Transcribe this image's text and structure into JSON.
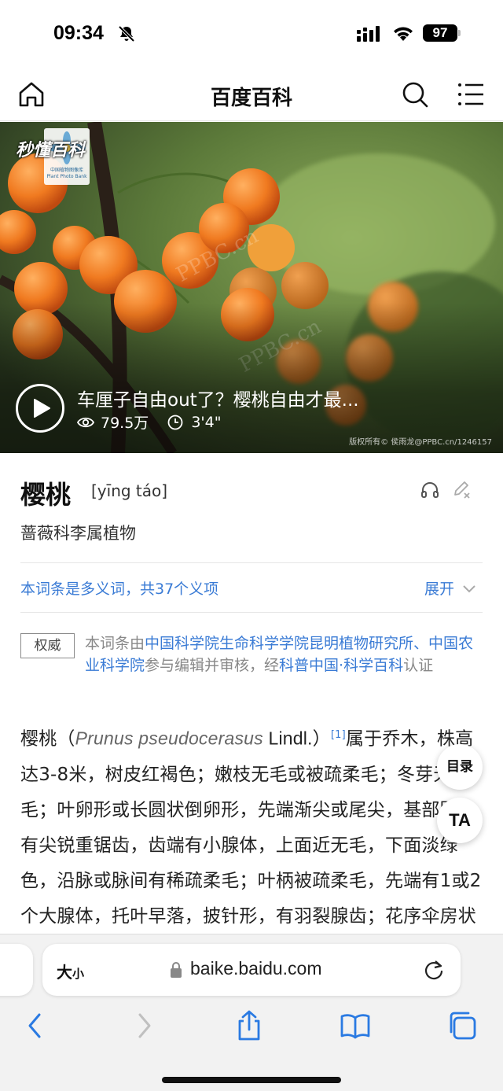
{
  "status_bar": {
    "time": "09:34",
    "battery": "97",
    "icons": [
      "bell-slash-icon",
      "cellular-signal-icon",
      "wifi-icon",
      "battery-icon"
    ]
  },
  "nav": {
    "title": "百度百科",
    "icons": [
      "home-icon",
      "search-icon",
      "menu-icon"
    ]
  },
  "hero": {
    "logo_text": "秒懂百科",
    "logo_badge": "中国植物图像库 Plant Photo Bank",
    "watermark": "PPBC.cn",
    "video_title": "车厘子自由out了？樱桃自由才最...",
    "views": "79.5万",
    "duration": "3'4\"",
    "copyright": "版权所有© 侯雨龙@PPBC.cn/1246157"
  },
  "entry": {
    "title": "樱桃",
    "pinyin": "[yīng táo]",
    "subtitle": "蔷薇科李属植物"
  },
  "polysemy": {
    "text": "本词条是多义词，共37个义项",
    "expand": "展开"
  },
  "authority": {
    "badge": "权威",
    "prefix": "本词条由",
    "org1": "中国科学院生命科学学院昆明植物研究所",
    "sep": "、",
    "org2": "中国农业科学院",
    "middle": "参与编辑并审核，经",
    "org3": "科普中国·科学百科",
    "suffix": "认证"
  },
  "body": {
    "lead": "樱桃（",
    "latin": "Prunus pseudocerasus",
    "author": " Lindl.）",
    "ref": "[1]",
    "text": "属于乔木，株高达3-8米，树皮红褐色；嫩枝无毛或被疏柔毛；冬芽无毛；叶卵形或长圆状倒卵形，先端渐尖或尾尖，基部圆，有尖锐重锯齿，齿端有小腺体，上面近无毛，下面淡绿色，沿脉或脉间有稀疏柔毛；叶柄被疏柔毛，先端有1或2个大腺体，托叶早落，披针形，有羽裂腺齿；花序伞房状或近伞形"
  },
  "floating": {
    "toc": "目录",
    "ta": "TA"
  },
  "browser": {
    "text_size": "大",
    "text_size_small": "小",
    "url": "baike.baidu.com",
    "toolbar": [
      "back-icon",
      "forward-icon",
      "share-icon",
      "bookmarks-icon",
      "tabs-icon"
    ]
  }
}
